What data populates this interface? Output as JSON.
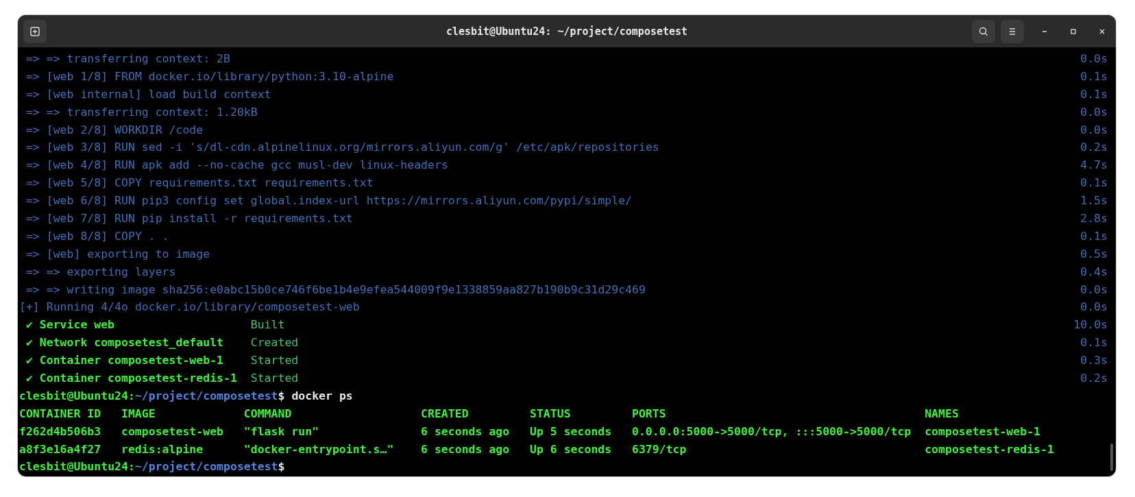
{
  "window": {
    "title": "clesbit@Ubuntu24: ~/project/composetest"
  },
  "terminal": {
    "lines": [
      {
        "kind": "build",
        "text": " => => transferring context: 2B",
        "time": "0.0s"
      },
      {
        "kind": "build",
        "text": " => [web 1/8] FROM docker.io/library/python:3.10-alpine",
        "time": "0.1s"
      },
      {
        "kind": "build",
        "text": " => [web internal] load build context",
        "time": "0.1s"
      },
      {
        "kind": "build",
        "text": " => => transferring context: 1.20kB",
        "time": "0.0s"
      },
      {
        "kind": "build",
        "text": " => [web 2/8] WORKDIR /code",
        "time": "0.0s"
      },
      {
        "kind": "build",
        "text": " => [web 3/8] RUN sed -i 's/dl-cdn.alpinelinux.org/mirrors.aliyun.com/g' /etc/apk/repositories",
        "time": "0.2s"
      },
      {
        "kind": "build",
        "text": " => [web 4/8] RUN apk add --no-cache gcc musl-dev linux-headers",
        "time": "4.7s"
      },
      {
        "kind": "build",
        "text": " => [web 5/8] COPY requirements.txt requirements.txt",
        "time": "0.1s"
      },
      {
        "kind": "build",
        "text": " => [web 6/8] RUN pip3 config set global.index-url https://mirrors.aliyun.com/pypi/simple/",
        "time": "1.5s"
      },
      {
        "kind": "build",
        "text": " => [web 7/8] RUN pip install -r requirements.txt",
        "time": "2.8s"
      },
      {
        "kind": "build",
        "text": " => [web 8/8] COPY . .",
        "time": "0.1s"
      },
      {
        "kind": "build",
        "text": " => [web] exporting to image",
        "time": "0.5s"
      },
      {
        "kind": "build",
        "text": " => => exporting layers",
        "time": "0.4s"
      },
      {
        "kind": "build",
        "text": " => => writing image sha256:e0abc15b0ce746f6be1b4e9efea544009f9e1338859aa827b190b9c31d29c469",
        "time": "0.0s"
      },
      {
        "kind": "build",
        "text": "[+] Running 4/4o docker.io/library/composetest-web",
        "time": "0.0s"
      },
      {
        "kind": "service",
        "mark": "✔",
        "name": "Service web",
        "status": "Built",
        "time": "10.0s"
      },
      {
        "kind": "service",
        "mark": "✔",
        "name": "Network composetest_default",
        "status": "Created",
        "time": "0.1s"
      },
      {
        "kind": "service",
        "mark": "✔",
        "name": "Container composetest-web-1",
        "status": "Started",
        "time": "0.3s"
      },
      {
        "kind": "service",
        "mark": "✔",
        "name": "Container composetest-redis-1",
        "status": "Started",
        "time": "0.2s"
      },
      {
        "kind": "prompt",
        "user_host": "clesbit@Ubuntu24:",
        "path": "~/project/composetest",
        "symbol": "$",
        "command": "docker ps"
      },
      {
        "kind": "table_header",
        "cells": [
          "CONTAINER ID",
          "IMAGE",
          "COMMAND",
          "CREATED",
          "STATUS",
          "PORTS",
          "NAMES"
        ]
      },
      {
        "kind": "table_row",
        "cells": [
          "f262d4b506b3",
          "composetest-web",
          "\"flask run\"",
          "6 seconds ago",
          "Up 5 seconds",
          "0.0.0.0:5000->5000/tcp, :::5000->5000/tcp",
          "composetest-web-1"
        ]
      },
      {
        "kind": "table_row",
        "cells": [
          "a8f3e16a4f27",
          "redis:alpine",
          "\"docker-entrypoint.s…\"",
          "6 seconds ago",
          "Up 6 seconds",
          "6379/tcp",
          "composetest-redis-1"
        ]
      },
      {
        "kind": "prompt",
        "user_host": "clesbit@Ubuntu24:",
        "path": "~/project/composetest",
        "symbol": "$"
      }
    ]
  }
}
